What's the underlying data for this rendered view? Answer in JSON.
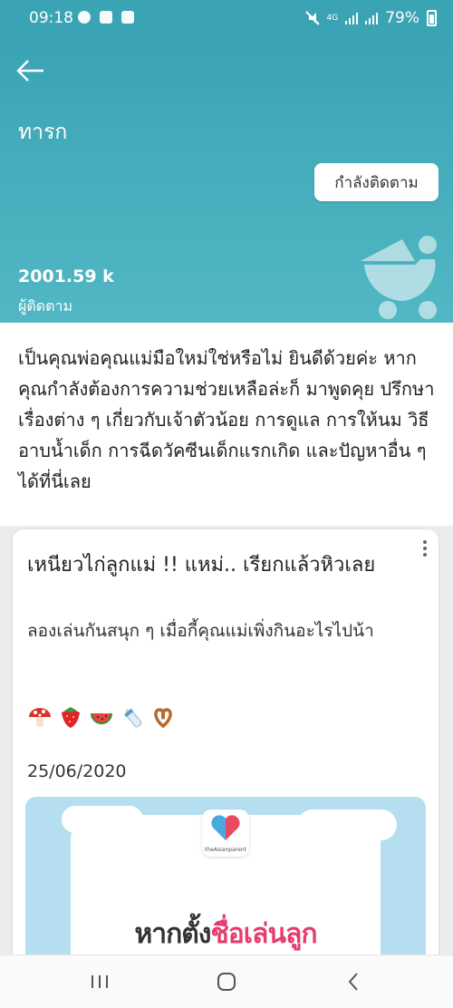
{
  "status_bar": {
    "time": "09:18",
    "battery": "79%",
    "left_icons": [
      "messenger-icon",
      "app-icon",
      "gallery-icon"
    ],
    "right_icons": [
      "mute-icon",
      "4g-signal-icon",
      "signal-icon",
      "signal-icon",
      "battery-icon"
    ]
  },
  "header": {
    "title": "ทารก",
    "follow_label": "กำลังติดตาม",
    "follower_count": "2001.59 k",
    "follower_label": "ผู้ติดตาม",
    "bg_color": "#3aa4b4"
  },
  "description": "เป็นคุณพ่อคุณแม่มือใหม่ใช่หรือไม่ ยินดีด้วยค่ะ หากคุณกำลังต้องการความช่วยเหลือล่ะก็ มาพูดคุย ปรึกษาเรื่องต่าง ๆ เกี่ยวกับเจ้าตัวน้อย การดูแล การให้นม วิธีอาบน้ำเด็ก การฉีดวัคซีนเด็กแรกเกิด และปัญหาอื่น ๆ ได้ที่นี่เลย",
  "post": {
    "title": "เหนียวไก่ลูกแม่ !! แหม่.. เรียกแล้วหิวเลย",
    "subtitle": "ลองเล่นกันสนุก ๆ เมื่อกี้คุณแม่เพิ่งกินอะไรไปน้า",
    "emojis": [
      "mushroom-icon",
      "strawberry-icon",
      "watermelon-icon",
      "baby-bottle-icon",
      "pretzel-icon"
    ],
    "date": "25/06/2020",
    "image": {
      "logo_text": "theAsianparent",
      "headline_part1": "หากตั้ง",
      "headline_part2": "ชื่อเล่นลูก",
      "accent_color": "#e43d6b"
    }
  },
  "nav_bar": {
    "buttons": [
      "recents-icon",
      "home-icon",
      "back-nav-icon"
    ]
  }
}
